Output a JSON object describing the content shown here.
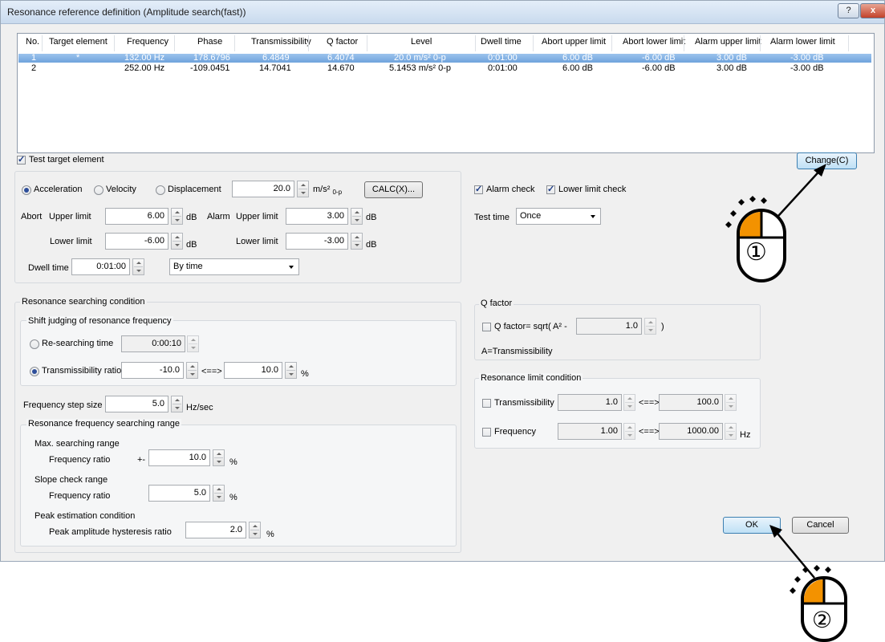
{
  "window": {
    "title": "Resonance reference definition (Amplitude search(fast))",
    "help_label": "?",
    "close_label": "x"
  },
  "table": {
    "headers": [
      "No.",
      "Target element",
      "Frequency",
      "Phase",
      "Transmissibility",
      "Q factor",
      "Level",
      "Dwell time",
      "Abort upper limit",
      "Abort lower limit",
      "Alarm upper limit",
      "Alarm lower limit"
    ],
    "rows": [
      {
        "no": "1",
        "target": "*",
        "frequency": "132.00 Hz",
        "phase": "178.6796",
        "transmissibility": "6.4849",
        "q_factor": "6.4074",
        "level": "20.0 m/s² 0-p",
        "dwell": "0:01:00",
        "abort_upper": "6.00 dB",
        "abort_lower": "-6.00 dB",
        "alarm_upper": "3.00 dB",
        "alarm_lower": "-3.00 dB",
        "selected": true
      },
      {
        "no": "2",
        "target": "",
        "frequency": "252.00 Hz",
        "phase": "-109.0451",
        "transmissibility": "14.7041",
        "q_factor": "14.670",
        "level": "5.1453 m/s² 0-p",
        "dwell": "0:01:00",
        "abort_upper": "6.00 dB",
        "abort_lower": "-6.00 dB",
        "alarm_upper": "3.00 dB",
        "alarm_lower": "-3.00 dB",
        "selected": false
      }
    ]
  },
  "test_target": {
    "label": "Test target element",
    "checked": true
  },
  "change_button": "Change(C)",
  "level": {
    "acceleration": "Acceleration",
    "velocity": "Velocity",
    "displacement": "Displacement",
    "value": "20.0",
    "unit_main": "m/s²",
    "unit_sub": "0-p",
    "calc_button": "CALC(X)..."
  },
  "abort": {
    "label": "Abort",
    "upper_label": "Upper limit",
    "upper_value": "6.00",
    "lower_label": "Lower limit",
    "lower_value": "-6.00",
    "unit": "dB"
  },
  "alarm": {
    "label": "Alarm",
    "upper_label": "Upper limit",
    "upper_value": "3.00",
    "lower_label": "Lower limit",
    "lower_value": "-3.00",
    "unit": "dB"
  },
  "dwell": {
    "label": "Dwell time",
    "value": "0:01:00",
    "mode": "By time"
  },
  "checks": {
    "alarm_check": "Alarm check",
    "lower_limit_check": "Lower limit check"
  },
  "test_time": {
    "label": "Test time",
    "value": "Once"
  },
  "search": {
    "group_title": "Resonance searching condition",
    "shift_title": "Shift judging of resonance frequency",
    "re_searching_label": "Re-searching time",
    "re_searching_value": "0:00:10",
    "trans_ratio_label": "Transmissibility ratio",
    "trans_ratio_low": "-10.0",
    "between": "<==>",
    "trans_ratio_high": "10.0",
    "percent": "%",
    "step_label": "Frequency step size",
    "step_value": "5.0",
    "step_unit": "Hz/sec",
    "range_title": "Resonance frequency searching range",
    "max_range_label": "Max. searching range",
    "freq_ratio_label": "Frequency ratio",
    "plus_minus": "+-",
    "max_range_value": "10.0",
    "slope_label": "Slope check range",
    "slope_value": "5.0",
    "peak_label": "Peak estimation condition",
    "peak_hyst_label": "Peak amplitude hysteresis ratio",
    "peak_hyst_value": "2.0"
  },
  "q_factor": {
    "group_title": "Q factor",
    "formula_label": "Q factor= sqrt( A² -",
    "value": "1.0",
    "close_paren": ")",
    "note": "A=Transmissibility"
  },
  "limit": {
    "group_title": "Resonance limit condition",
    "trans_label": "Transmissibility",
    "trans_low": "1.0",
    "trans_high": "100.0",
    "freq_label": "Frequency",
    "freq_low": "1.00",
    "freq_high": "1000.00",
    "between": "<==>",
    "hz": "Hz"
  },
  "ok_button": "OK",
  "cancel_button": "Cancel",
  "annotations": {
    "step1": "①",
    "step2": "②",
    "mouse_color": "#f39200"
  }
}
